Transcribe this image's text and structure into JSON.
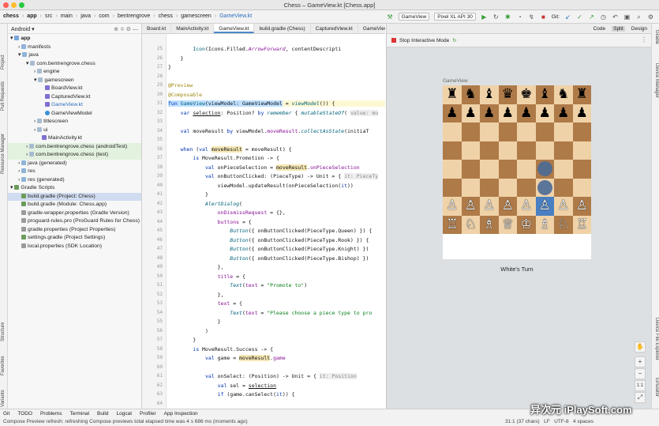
{
  "window": {
    "title": "Chess – GameView.kt [Chess.app]"
  },
  "breadcrumbs": [
    "chess",
    "app",
    "src",
    "main",
    "java",
    "com",
    "bentrengrove",
    "chess",
    "gamescreen",
    "GameView.kt"
  ],
  "toolbar": {
    "config": "GameView",
    "device": "Pixel XL API 30",
    "git_label": "Git:"
  },
  "project": {
    "view": "Android",
    "tree": [
      {
        "label": "app",
        "indent": 0
      },
      {
        "label": "manifests",
        "indent": 1
      },
      {
        "label": "java",
        "indent": 1
      },
      {
        "label": "com.bentrengrove.chess",
        "indent": 2
      },
      {
        "label": "engine",
        "indent": 3
      },
      {
        "label": "gamescreen",
        "indent": 3
      },
      {
        "label": "BoardView.kt",
        "indent": 4
      },
      {
        "label": "CapturedView.kt",
        "indent": 4
      },
      {
        "label": "GameView.kt",
        "indent": 4
      },
      {
        "label": "GameViewModel",
        "indent": 4
      },
      {
        "label": "titlescreen",
        "indent": 3
      },
      {
        "label": "ui",
        "indent": 3
      },
      {
        "label": "MainActivity.kt",
        "indent": 3
      },
      {
        "label": "com.bentrengrove.chess (androidTest)",
        "indent": 2
      },
      {
        "label": "com.bentrengrove.chess (test)",
        "indent": 2
      },
      {
        "label": "java (generated)",
        "indent": 1
      },
      {
        "label": "res",
        "indent": 1
      },
      {
        "label": "res (generated)",
        "indent": 1
      },
      {
        "label": "Gradle Scripts",
        "indent": 0
      },
      {
        "label": "build.gradle (Project: Chess)",
        "indent": 1
      },
      {
        "label": "build.gradle (Module: Chess.app)",
        "indent": 1
      },
      {
        "label": "gradle-wrapper.properties (Gradle Version)",
        "indent": 1
      },
      {
        "label": "proguard-rules.pro (ProGuard Rules for Chess)",
        "indent": 1
      },
      {
        "label": "gradle.properties (Project Properties)",
        "indent": 1
      },
      {
        "label": "settings.gradle (Project Settings)",
        "indent": 1
      },
      {
        "label": "local.properties (SDK Location)",
        "indent": 1
      }
    ]
  },
  "tabs": [
    "Board.kt",
    "MainActivity.kt",
    "GameView.kt",
    "build.gradle (Chess)",
    "CapturedView.kt",
    "GameViewModel.kt"
  ],
  "code": {
    "line_numbers": [
      "25",
      "26",
      "27",
      "28",
      "29",
      "30",
      "31",
      "32",
      "33",
      "34",
      "35",
      "36",
      "37",
      "38",
      "39",
      "40",
      "41",
      "42",
      "43",
      "44",
      "45",
      "46",
      "47",
      "48",
      "49",
      "50",
      "51",
      "52",
      "53",
      "54",
      "55",
      "56",
      "57",
      "58",
      "59",
      "60",
      "61",
      "62",
      "63",
      "64"
    ],
    "hints": {
      "value": "value: mu",
      "pieceType": "it: PieceTy",
      "position": "it: Position"
    }
  },
  "preview": {
    "mode_buttons": [
      "Code",
      "Split",
      "Design"
    ],
    "stop_label": "Stop Interactive Mode",
    "component_label": "GameView",
    "turn_text": "White's Turn"
  },
  "board": {
    "rows": [
      [
        "♜",
        "♞",
        "♝",
        "♛",
        "♚",
        "♝",
        "♞",
        "♜"
      ],
      [
        "♟",
        "♟",
        "♟",
        "♟",
        "♟",
        "♟",
        "♟",
        "♟"
      ],
      [
        "",
        "",
        "",
        "",
        "",
        "",
        "",
        ""
      ],
      [
        "",
        "",
        "",
        "",
        "",
        "",
        "",
        ""
      ],
      [
        "",
        "",
        "",
        "",
        "",
        "●",
        "",
        ""
      ],
      [
        "",
        "",
        "",
        "",
        "",
        "●",
        "",
        ""
      ],
      [
        "♙",
        "♙",
        "♙",
        "♙",
        "♙",
        "♙",
        "♙",
        "♙"
      ],
      [
        "♖",
        "♘",
        "♗",
        "♕",
        "♔",
        "♗",
        "♘",
        "♖"
      ]
    ]
  },
  "statusbar": {
    "tabs": [
      "Git",
      "TODO",
      "Problems",
      "Terminal",
      "Build",
      "Logcat",
      "Profiler",
      "App Inspection"
    ],
    "message": "Compose Preview refresh: refreshing Compose previews total elapsed time was 4 s 686 ms (moments ago)",
    "position": "31:1 (37 chars)",
    "lf": "LF",
    "encoding": "UTF-8",
    "indent": "4 spaces"
  },
  "left_strip": [
    "Project",
    "Pull Requests",
    "Resource Manager",
    "Structure",
    "Favorites",
    "Build Variants"
  ],
  "right_strip": [
    "Gradle",
    "Device Manager",
    "Device File Explorer",
    "Emulator"
  ],
  "watermark": "异次元 iPlaySoft.com",
  "colors": {
    "light_square": "#f0d2a8",
    "dark_square": "#ae7a48",
    "selected_square": "#4a7fc1"
  }
}
